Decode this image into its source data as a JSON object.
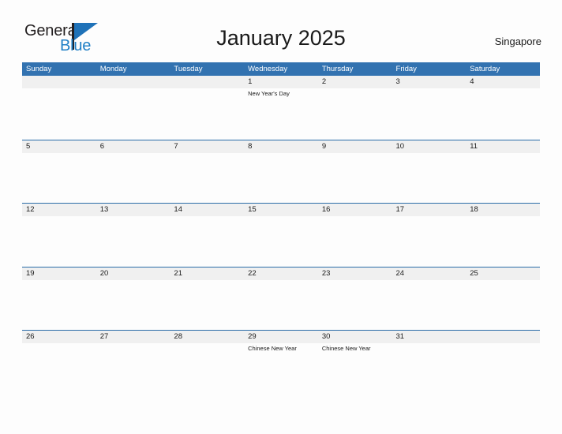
{
  "header": {
    "logo": {
      "word_one": "General",
      "word_two": "Blue"
    },
    "title": "January 2025",
    "locale": "Singapore"
  },
  "calendar": {
    "weekdays": [
      "Sunday",
      "Monday",
      "Tuesday",
      "Wednesday",
      "Thursday",
      "Friday",
      "Saturday"
    ],
    "accent_color": "#3272b0",
    "band_color": "#f0f0f0",
    "weeks": [
      [
        {
          "date": "",
          "events": []
        },
        {
          "date": "",
          "events": []
        },
        {
          "date": "",
          "events": []
        },
        {
          "date": "1",
          "events": [
            "New Year's Day"
          ]
        },
        {
          "date": "2",
          "events": []
        },
        {
          "date": "3",
          "events": []
        },
        {
          "date": "4",
          "events": []
        }
      ],
      [
        {
          "date": "5",
          "events": []
        },
        {
          "date": "6",
          "events": []
        },
        {
          "date": "7",
          "events": []
        },
        {
          "date": "8",
          "events": []
        },
        {
          "date": "9",
          "events": []
        },
        {
          "date": "10",
          "events": []
        },
        {
          "date": "11",
          "events": []
        }
      ],
      [
        {
          "date": "12",
          "events": []
        },
        {
          "date": "13",
          "events": []
        },
        {
          "date": "14",
          "events": []
        },
        {
          "date": "15",
          "events": []
        },
        {
          "date": "16",
          "events": []
        },
        {
          "date": "17",
          "events": []
        },
        {
          "date": "18",
          "events": []
        }
      ],
      [
        {
          "date": "19",
          "events": []
        },
        {
          "date": "20",
          "events": []
        },
        {
          "date": "21",
          "events": []
        },
        {
          "date": "22",
          "events": []
        },
        {
          "date": "23",
          "events": []
        },
        {
          "date": "24",
          "events": []
        },
        {
          "date": "25",
          "events": []
        }
      ],
      [
        {
          "date": "26",
          "events": []
        },
        {
          "date": "27",
          "events": []
        },
        {
          "date": "28",
          "events": []
        },
        {
          "date": "29",
          "events": [
            "Chinese New Year"
          ]
        },
        {
          "date": "30",
          "events": [
            "Chinese New Year"
          ]
        },
        {
          "date": "31",
          "events": []
        },
        {
          "date": "",
          "events": []
        }
      ]
    ]
  }
}
